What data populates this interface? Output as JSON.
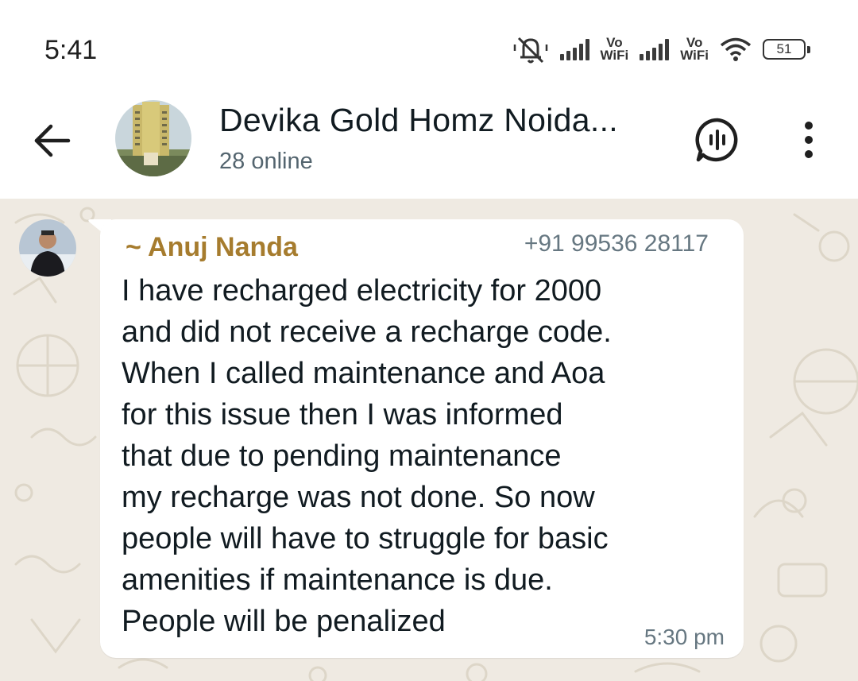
{
  "status_bar": {
    "time": "5:41",
    "sim1_label": "Vo\nWiFi",
    "sim2_label": "Vo\nWiFi",
    "battery": "51"
  },
  "header": {
    "title": "Devika Gold Homz Noida...",
    "subtitle": "28 online",
    "icons": [
      "back-arrow-icon",
      "group-avatar",
      "voice-chat-icon",
      "more-vertical-icon"
    ]
  },
  "message": {
    "sender_name": "~ Anuj Nanda",
    "sender_phone": "+91 99536 28117",
    "text": "I have recharged electricity for 2000\nand did not receive a recharge code.\nWhen I called maintenance  and Aoa\nfor this issue then I was informed\nthat due to pending maintenance\nmy recharge was not done. So now\npeople will have to struggle for basic\namenities if maintenance is due.\nPeople will be penalized",
    "time": "5:30 pm"
  },
  "colors": {
    "chat_background": "#efeae2",
    "sender_name": "#a67c2e",
    "bubble": "#ffffff"
  }
}
